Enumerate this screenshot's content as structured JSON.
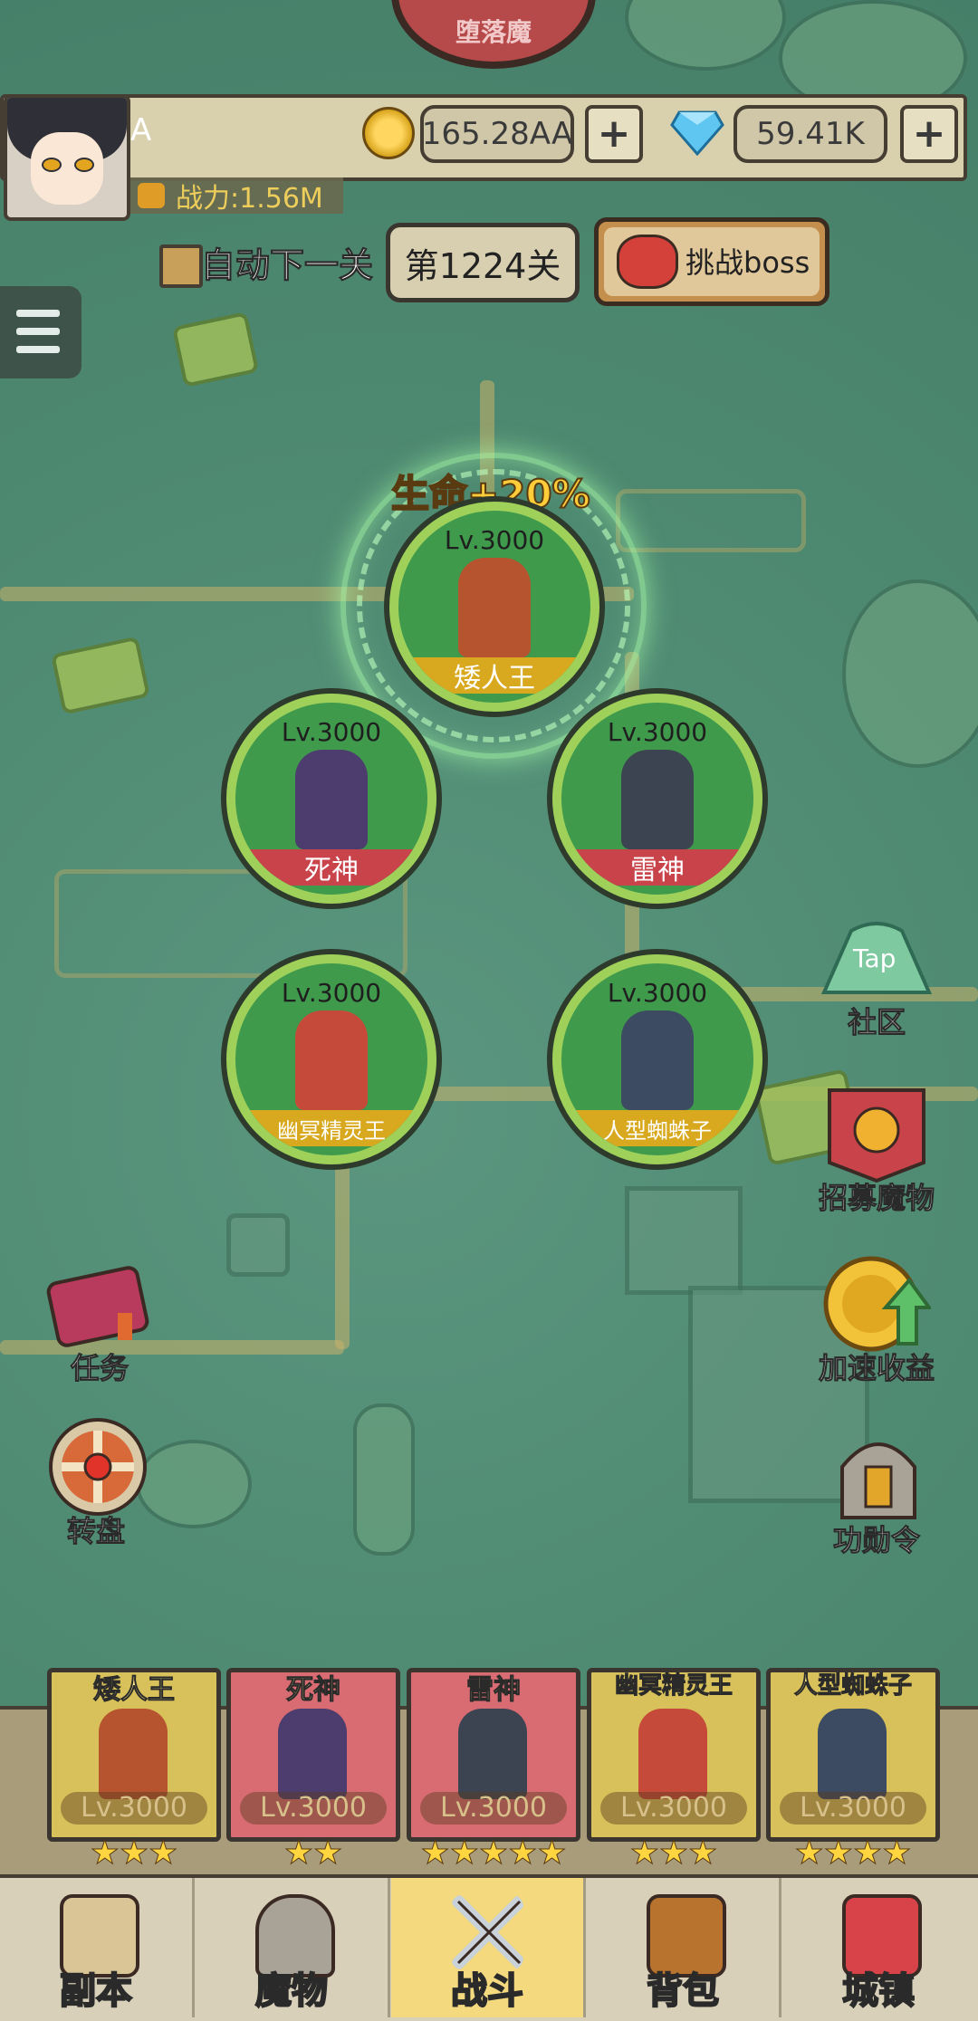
{
  "top_boss": {
    "name": "堕落魔"
  },
  "player": {
    "name": "A",
    "coins": "165.28AA",
    "gems": "59.41K",
    "power": "战力:1.56M"
  },
  "controls": {
    "auto_next_label": "自动下一关",
    "stage_label": "第1224关",
    "challenge_boss_label": "挑战boss"
  },
  "formation": {
    "buff": "生命+20%",
    "slots": [
      {
        "level": "Lv.3000",
        "name": "矮人王"
      },
      {
        "level": "Lv.3000",
        "name": "死神"
      },
      {
        "level": "Lv.3000",
        "name": "雷神"
      },
      {
        "level": "Lv.3000",
        "name": "幽冥精灵王"
      },
      {
        "level": "Lv.3000",
        "name": "人型蜘蛛子"
      }
    ]
  },
  "side_left": [
    {
      "icon": "quest-book-icon",
      "label": "任务"
    },
    {
      "icon": "wheel-icon",
      "label": "转盘"
    }
  ],
  "side_right": [
    {
      "icon": "taptap-icon",
      "label": "社区",
      "icon_text": "Tap"
    },
    {
      "icon": "recruit-banner-icon",
      "label": "招募魔物"
    },
    {
      "icon": "speed-coin-icon",
      "label": "加速收益"
    },
    {
      "icon": "helmet-icon",
      "label": "功勋令"
    }
  ],
  "team": [
    {
      "name": "矮人王",
      "level": "Lv.3000",
      "stars": "★★★"
    },
    {
      "name": "死神",
      "level": "Lv.3000",
      "stars": "★★"
    },
    {
      "name": "雷神",
      "level": "Lv.3000",
      "stars": "★★★★★"
    },
    {
      "name": "幽冥精灵王",
      "level": "Lv.3000",
      "stars": "★★★"
    },
    {
      "name": "人型蜘蛛子",
      "level": "Lv.3000",
      "stars": "★★★★"
    }
  ],
  "nav": [
    {
      "label": "副本"
    },
    {
      "label": "魔物"
    },
    {
      "label": "战斗",
      "active": true
    },
    {
      "label": "背包"
    },
    {
      "label": "城镇"
    }
  ],
  "colors": {
    "map_bg": "#4f8a73",
    "slot_ring": "#9ed05a",
    "gold_band": "#d8a81e",
    "red_band": "#c8434a",
    "active_tab": "#f5d97e"
  }
}
